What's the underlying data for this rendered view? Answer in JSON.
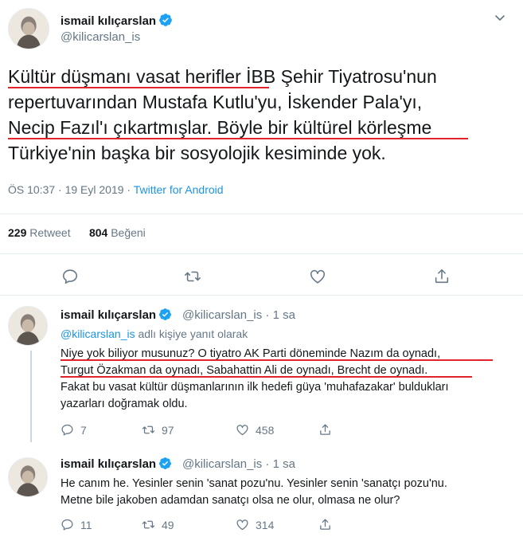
{
  "main_tweet": {
    "name": "ismail kılıçarslan",
    "handle": "@kilicarslan_is",
    "text_lines": [
      "Kültür düşmanı vasat herifler İBB Şehir Tiyatrosu'nun",
      "repertuvarından Mustafa Kutlu'yu, İskender Pala'yı,",
      "Necip Fazıl'ı çıkartmışlar. Böyle bir kültürel körleşme",
      "Türkiye'nin başka bir sosyolojik kesiminde yok."
    ],
    "time": "ÖS 10:37 · 19 Eyl 2019 · ",
    "source": "Twitter for Android",
    "retweet_count": "229",
    "retweet_label": "Retweet",
    "like_count": "804",
    "like_label": "Beğeni"
  },
  "replies": [
    {
      "name": "ismail kılıçarslan",
      "handle_time": "@kilicarslan_is · 1 sa",
      "reply_mention": "@kilicarslan_is",
      "reply_suffix": " adlı kişiye yanıt olarak",
      "text_lines": [
        "Niye yok biliyor musunuz? O tiyatro AK Parti döneminde Nazım da oynadı,",
        "Turgut Özakman da oynadı, Sabahattin Ali de oynadı, Brecht de oynadı.",
        "Fakat bu vasat kültür düşmanlarının ilk hedefi güya 'muhafazakar' buldukları",
        "yazarları doğramak oldu."
      ],
      "replies": "7",
      "retweets": "97",
      "likes": "458"
    },
    {
      "name": "ismail kılıçarslan",
      "handle_time": "@kilicarslan_is · 1 sa",
      "text_lines": [
        "He canım he. Yesinler senin 'sanat pozu'nu. Yesinler senin 'sanatçı pozu'nu.",
        "Metne bile jakoben adamdan sanatçı olsa ne olur, olmasa ne olur?"
      ],
      "replies": "11",
      "retweets": "49",
      "likes": "314"
    }
  ],
  "colors": {
    "accent": "#1b95e0",
    "underline": "#e0242a",
    "muted": "#657786"
  },
  "icons": [
    "chevron-down-icon",
    "verified-badge-icon",
    "reply-icon",
    "retweet-icon",
    "like-icon",
    "share-icon"
  ]
}
